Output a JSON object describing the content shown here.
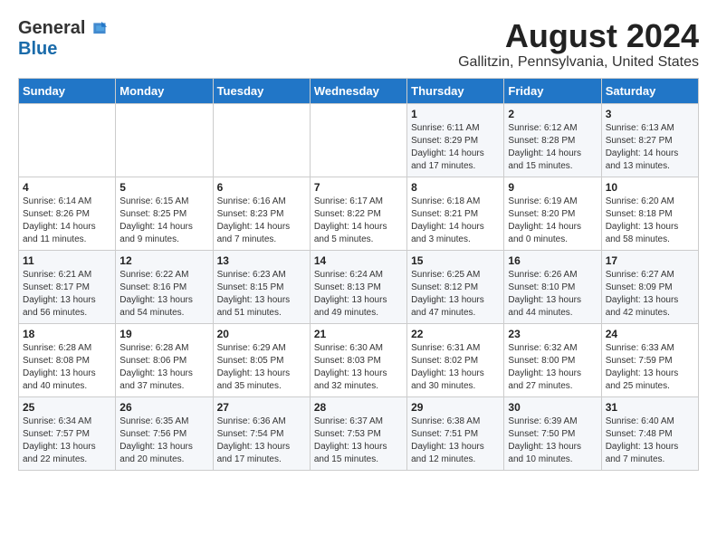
{
  "logo": {
    "general": "General",
    "blue": "Blue"
  },
  "title": "August 2024",
  "location": "Gallitzin, Pennsylvania, United States",
  "days_of_week": [
    "Sunday",
    "Monday",
    "Tuesday",
    "Wednesday",
    "Thursday",
    "Friday",
    "Saturday"
  ],
  "weeks": [
    [
      {
        "day": "",
        "content": ""
      },
      {
        "day": "",
        "content": ""
      },
      {
        "day": "",
        "content": ""
      },
      {
        "day": "",
        "content": ""
      },
      {
        "day": "1",
        "content": "Sunrise: 6:11 AM\nSunset: 8:29 PM\nDaylight: 14 hours\nand 17 minutes."
      },
      {
        "day": "2",
        "content": "Sunrise: 6:12 AM\nSunset: 8:28 PM\nDaylight: 14 hours\nand 15 minutes."
      },
      {
        "day": "3",
        "content": "Sunrise: 6:13 AM\nSunset: 8:27 PM\nDaylight: 14 hours\nand 13 minutes."
      }
    ],
    [
      {
        "day": "4",
        "content": "Sunrise: 6:14 AM\nSunset: 8:26 PM\nDaylight: 14 hours\nand 11 minutes."
      },
      {
        "day": "5",
        "content": "Sunrise: 6:15 AM\nSunset: 8:25 PM\nDaylight: 14 hours\nand 9 minutes."
      },
      {
        "day": "6",
        "content": "Sunrise: 6:16 AM\nSunset: 8:23 PM\nDaylight: 14 hours\nand 7 minutes."
      },
      {
        "day": "7",
        "content": "Sunrise: 6:17 AM\nSunset: 8:22 PM\nDaylight: 14 hours\nand 5 minutes."
      },
      {
        "day": "8",
        "content": "Sunrise: 6:18 AM\nSunset: 8:21 PM\nDaylight: 14 hours\nand 3 minutes."
      },
      {
        "day": "9",
        "content": "Sunrise: 6:19 AM\nSunset: 8:20 PM\nDaylight: 14 hours\nand 0 minutes."
      },
      {
        "day": "10",
        "content": "Sunrise: 6:20 AM\nSunset: 8:18 PM\nDaylight: 13 hours\nand 58 minutes."
      }
    ],
    [
      {
        "day": "11",
        "content": "Sunrise: 6:21 AM\nSunset: 8:17 PM\nDaylight: 13 hours\nand 56 minutes."
      },
      {
        "day": "12",
        "content": "Sunrise: 6:22 AM\nSunset: 8:16 PM\nDaylight: 13 hours\nand 54 minutes."
      },
      {
        "day": "13",
        "content": "Sunrise: 6:23 AM\nSunset: 8:15 PM\nDaylight: 13 hours\nand 51 minutes."
      },
      {
        "day": "14",
        "content": "Sunrise: 6:24 AM\nSunset: 8:13 PM\nDaylight: 13 hours\nand 49 minutes."
      },
      {
        "day": "15",
        "content": "Sunrise: 6:25 AM\nSunset: 8:12 PM\nDaylight: 13 hours\nand 47 minutes."
      },
      {
        "day": "16",
        "content": "Sunrise: 6:26 AM\nSunset: 8:10 PM\nDaylight: 13 hours\nand 44 minutes."
      },
      {
        "day": "17",
        "content": "Sunrise: 6:27 AM\nSunset: 8:09 PM\nDaylight: 13 hours\nand 42 minutes."
      }
    ],
    [
      {
        "day": "18",
        "content": "Sunrise: 6:28 AM\nSunset: 8:08 PM\nDaylight: 13 hours\nand 40 minutes."
      },
      {
        "day": "19",
        "content": "Sunrise: 6:28 AM\nSunset: 8:06 PM\nDaylight: 13 hours\nand 37 minutes."
      },
      {
        "day": "20",
        "content": "Sunrise: 6:29 AM\nSunset: 8:05 PM\nDaylight: 13 hours\nand 35 minutes."
      },
      {
        "day": "21",
        "content": "Sunrise: 6:30 AM\nSunset: 8:03 PM\nDaylight: 13 hours\nand 32 minutes."
      },
      {
        "day": "22",
        "content": "Sunrise: 6:31 AM\nSunset: 8:02 PM\nDaylight: 13 hours\nand 30 minutes."
      },
      {
        "day": "23",
        "content": "Sunrise: 6:32 AM\nSunset: 8:00 PM\nDaylight: 13 hours\nand 27 minutes."
      },
      {
        "day": "24",
        "content": "Sunrise: 6:33 AM\nSunset: 7:59 PM\nDaylight: 13 hours\nand 25 minutes."
      }
    ],
    [
      {
        "day": "25",
        "content": "Sunrise: 6:34 AM\nSunset: 7:57 PM\nDaylight: 13 hours\nand 22 minutes."
      },
      {
        "day": "26",
        "content": "Sunrise: 6:35 AM\nSunset: 7:56 PM\nDaylight: 13 hours\nand 20 minutes."
      },
      {
        "day": "27",
        "content": "Sunrise: 6:36 AM\nSunset: 7:54 PM\nDaylight: 13 hours\nand 17 minutes."
      },
      {
        "day": "28",
        "content": "Sunrise: 6:37 AM\nSunset: 7:53 PM\nDaylight: 13 hours\nand 15 minutes."
      },
      {
        "day": "29",
        "content": "Sunrise: 6:38 AM\nSunset: 7:51 PM\nDaylight: 13 hours\nand 12 minutes."
      },
      {
        "day": "30",
        "content": "Sunrise: 6:39 AM\nSunset: 7:50 PM\nDaylight: 13 hours\nand 10 minutes."
      },
      {
        "day": "31",
        "content": "Sunrise: 6:40 AM\nSunset: 7:48 PM\nDaylight: 13 hours\nand 7 minutes."
      }
    ]
  ]
}
